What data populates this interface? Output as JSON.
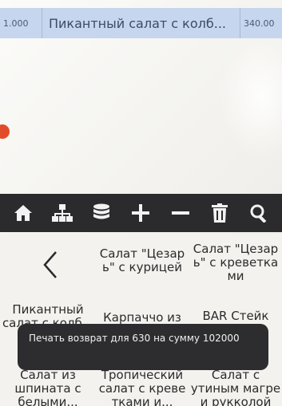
{
  "order": {
    "qty": "1.000",
    "item_name": "Пикантный салат с колб...",
    "price": "340.00"
  },
  "toolbar": {
    "buttons": [
      {
        "icon": "home-icon"
      },
      {
        "icon": "categories-icon"
      },
      {
        "icon": "coins-icon"
      },
      {
        "icon": "plus-icon"
      },
      {
        "icon": "minus-icon"
      },
      {
        "icon": "trash-icon"
      },
      {
        "icon": "search-icon"
      }
    ]
  },
  "menu": {
    "back_icon": "chevron-left-icon",
    "items": [
      "Салат \"Цезар ь\" с курицей",
      "Салат \"Цезар ь\" с креветка ми",
      "Пикантный салат с колб...",
      "Карпаччо из",
      "BAR Стейк",
      "Салат из шпината с белыми...",
      "Тропический салат с креве тками и...",
      "Салат с утиным магре и рукколой"
    ]
  },
  "toast": {
    "message": "Печать возврат для 630 на сумму 102000"
  }
}
